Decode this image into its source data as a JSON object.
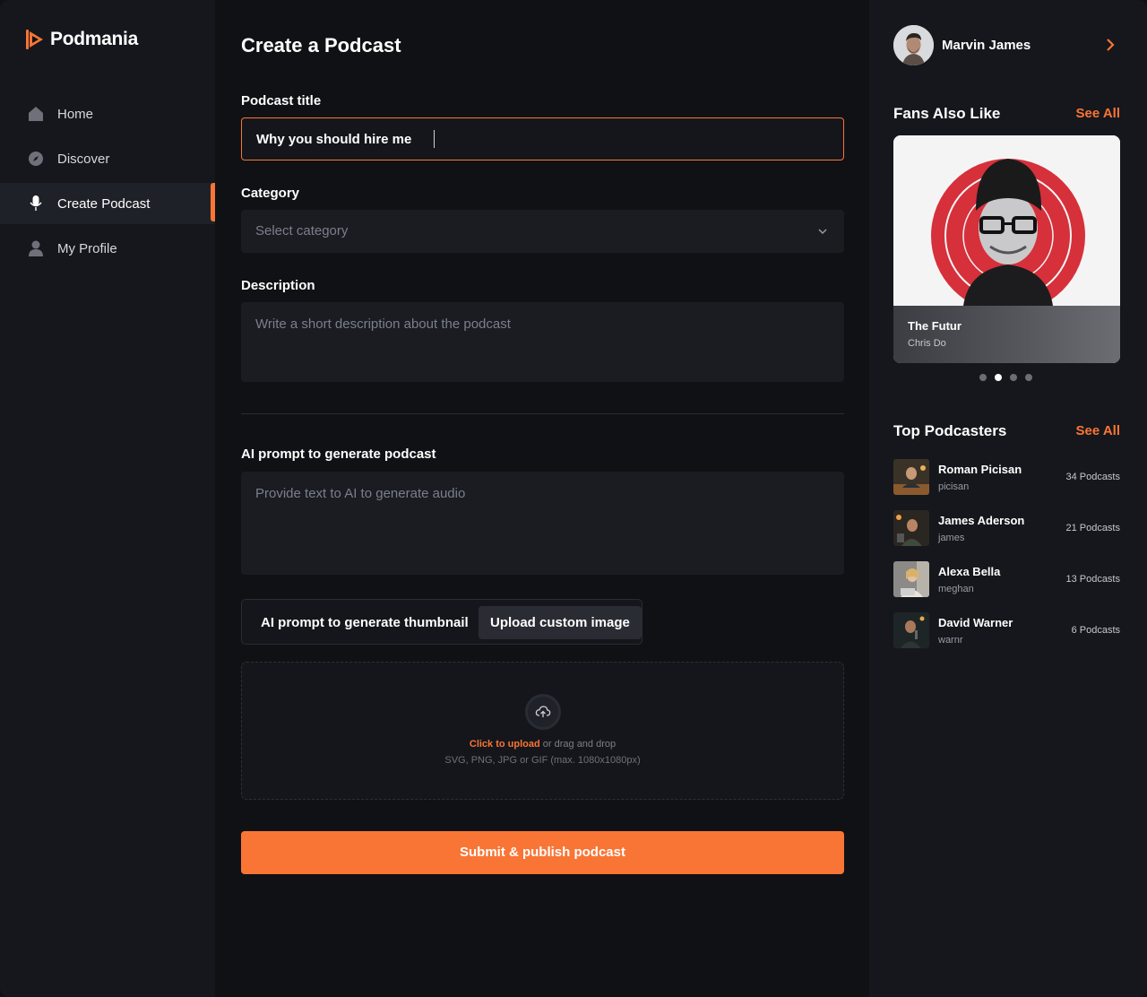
{
  "brand": {
    "name": "Podmania",
    "accent": "#f97535"
  },
  "sidebar": {
    "items": [
      {
        "label": "Home",
        "icon": "home-icon",
        "active": false
      },
      {
        "label": "Discover",
        "icon": "compass-icon",
        "active": false
      },
      {
        "label": "Create Podcast",
        "icon": "microphone-icon",
        "active": true
      },
      {
        "label": "My Profile",
        "icon": "user-icon",
        "active": false
      }
    ]
  },
  "main": {
    "title": "Create a Podcast",
    "podcast_title": {
      "label": "Podcast title",
      "value": "Why you should hire me"
    },
    "category": {
      "label": "Category",
      "placeholder": "Select category"
    },
    "description": {
      "label": "Description",
      "placeholder": "Write a short description about the podcast"
    },
    "ai_audio": {
      "label": "AI prompt to generate podcast",
      "placeholder": "Provide text to AI to generate audio"
    },
    "thumbnail_toggle": {
      "option_ai": "AI prompt to generate thumbnail",
      "option_upload": "Upload custom image",
      "selected": "Upload custom image"
    },
    "upload": {
      "click_text": "Click to upload",
      "drag_text": "or drag and drop",
      "formats": "SVG, PNG, JPG or GIF (max. 1080x1080px)"
    },
    "submit_label": "Submit & publish podcast"
  },
  "right": {
    "user": {
      "name": "Marvin James"
    },
    "fans_also_like": {
      "title": "Fans Also Like",
      "see_all": "See All",
      "card": {
        "title": "The Futur",
        "author": "Chris Do"
      },
      "carousel_total": 4,
      "carousel_active": 2
    },
    "top_podcasters": {
      "title": "Top Podcasters",
      "see_all": "See All",
      "items": [
        {
          "name": "Roman Picisan",
          "handle": "picisan",
          "count": "34 Podcasts"
        },
        {
          "name": "James Aderson",
          "handle": "james",
          "count": "21 Podcasts"
        },
        {
          "name": "Alexa Bella",
          "handle": "meghan",
          "count": "13 Podcasts"
        },
        {
          "name": "David Warner",
          "handle": "warnr",
          "count": "6 Podcasts"
        }
      ]
    }
  }
}
